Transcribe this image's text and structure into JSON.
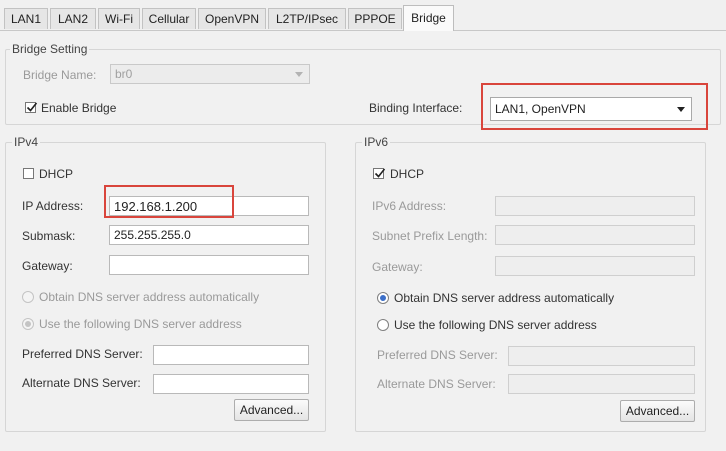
{
  "tabs": [
    "LAN1",
    "LAN2",
    "Wi-Fi",
    "Cellular",
    "OpenVPN",
    "L2TP/IPsec",
    "PPPOE",
    "Bridge"
  ],
  "bridge_setting": {
    "legend": "Bridge Setting",
    "name_label": "Bridge Name:",
    "name_value": "br0",
    "enable_label": "Enable Bridge",
    "enable_checked": true,
    "binding_label": "Binding Interface:",
    "binding_value": "LAN1, OpenVPN"
  },
  "ipv4": {
    "legend": "IPv4",
    "dhcp_label": "DHCP",
    "dhcp_checked": false,
    "ip_label": "IP Address:",
    "ip_value": "192.168.1.200",
    "mask_label": "Submask:",
    "mask_value": "255.255.255.0",
    "gateway_label": "Gateway:",
    "gateway_value": "",
    "dns_auto_label": "Obtain DNS server address automatically",
    "dns_manual_label": "Use the following DNS server address",
    "preferred_dns_label": "Preferred DNS Server:",
    "alternate_dns_label": "Alternate DNS Server:",
    "advanced_label": "Advanced..."
  },
  "ipv6": {
    "legend": "IPv6",
    "dhcp_label": "DHCP",
    "dhcp_checked": true,
    "address_label": "IPv6 Address:",
    "prefix_label": "Subnet Prefix Length:",
    "gateway_label": "Gateway:",
    "dns_auto_label": "Obtain DNS server address automatically",
    "dns_manual_label": "Use the following DNS server address",
    "preferred_dns_label": "Preferred DNS Server:",
    "alternate_dns_label": "Alternate DNS Server:",
    "advanced_label": "Advanced..."
  },
  "colors": {
    "highlight": "#d9453c",
    "radio_selected": "#3c6fc9"
  }
}
